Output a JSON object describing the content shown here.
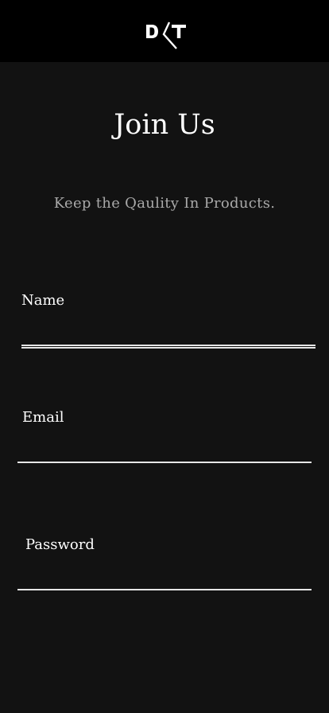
{
  "header": {
    "logo_icon": "dt-monogram-logo-icon"
  },
  "page": {
    "title": "Join Us",
    "subtitle": "Keep the Qaulity In Products."
  },
  "form": {
    "name": {
      "label": "Name",
      "value": ""
    },
    "email": {
      "label": "Email",
      "value": ""
    },
    "password": {
      "label": "Password",
      "value": ""
    }
  },
  "colors": {
    "header_bg": "#000000",
    "page_bg": "#121212",
    "text": "#ffffff",
    "subtitle": "#a9a9a9",
    "underline": "#e6e6e6"
  }
}
